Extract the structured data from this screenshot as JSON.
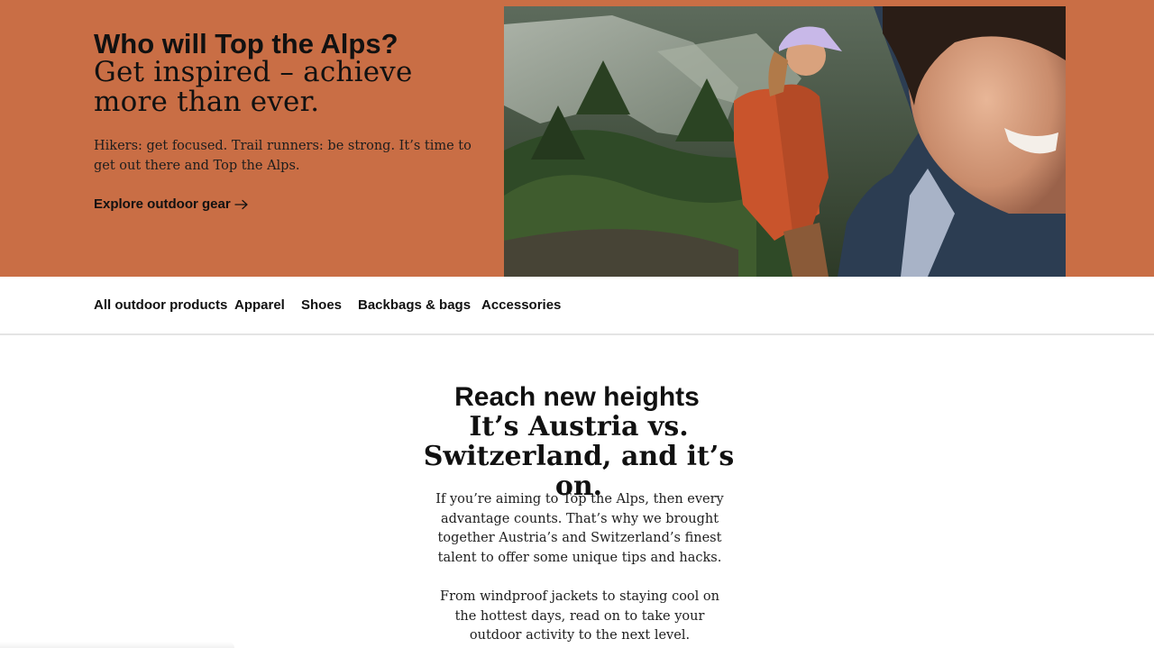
{
  "hero": {
    "title": "Who will Top the Alps?",
    "subtitle": "Get inspired – achieve more than ever.",
    "body": "Hikers: get focused. Trail runners: be strong. It’s time to get out there and Top the Alps.",
    "link_label": "Explore outdoor gear",
    "link_icon": "arrow-right-icon",
    "background_color": "#c96e45"
  },
  "subnav": {
    "items": [
      {
        "label": "All outdoor products"
      },
      {
        "label": "Apparel"
      },
      {
        "label": "Shoes"
      },
      {
        "label": "Backbags & bags"
      },
      {
        "label": "Accessories"
      }
    ]
  },
  "section": {
    "title": "Reach new heights",
    "subtitle": "It’s Austria vs. Switzerland, and it’s on.",
    "paragraph1": "If you’re aiming to Top the Alps, then every advantage counts. That’s why we brought together Austria’s and Switzerland’s finest talent to offer some unique tips and hacks.",
    "paragraph2": "From windproof jackets to staying cool on the hottest days, read on to take your outdoor activity to the next level."
  }
}
